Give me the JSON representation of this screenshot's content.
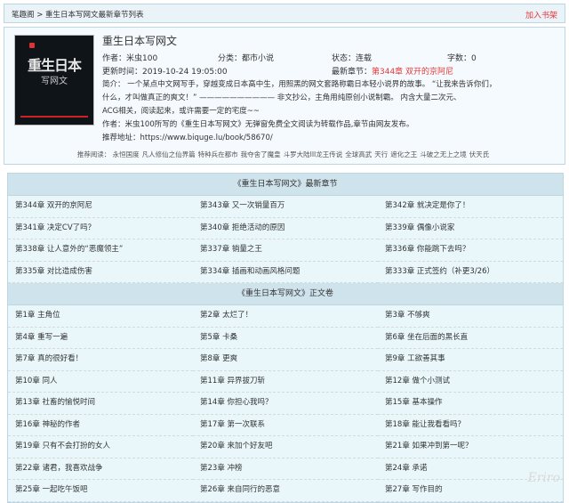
{
  "topbar": {
    "breadcrumb": "笔趣阁 > 重生日本写网文最新章节列表",
    "add_shelf": "加入书架"
  },
  "book": {
    "title": "重生日本写网文",
    "cover_title": "重生日本",
    "cover_subtitle": "写网文",
    "author": "作者：米虫100",
    "category": "分类：都市小说",
    "status": "状态：连载",
    "words": "字数：0",
    "updated": "更新时间：2019-10-24 19:05:00",
    "latest_label": "最新章节：",
    "latest_chapter": "第344章 双开的京阿尼",
    "intro_line1": "简介：           一个某点中文网写手，穿越变成日本高中生，用照黑的网文套路称霸日本轻小说界的故事。        “让我来告诉你们，",
    "intro_line2": "什么，才叫做真正的爽文！”          ——————————           非文抄公，主角用纯原创小说制霸。        内含大量二次元、",
    "intro_line3": "ACG相关，阅读起来，或许需要一定的宅度~~",
    "statement": "作者：米虫100所写的《重生日本写网文》无弹窗免费全文阅读为转载作品,章节由网友发布。",
    "address": "推荐地址：https://www.biquge.lu/book/58670/"
  },
  "recommend": {
    "label": "推荐阅读：",
    "items": [
      "永恒国度",
      "凡人修仙之仙界篇",
      "特种兵在都市",
      "我夺舍了魔皇",
      "斗罗大陆III龙王传说",
      "全球高武",
      "天行",
      "遮化之王",
      "斗破之无上之境",
      "伏天氏"
    ]
  },
  "latest_section": {
    "header": "《重生日本写网文》最新章节",
    "chapters": [
      "第344章 双开的京阿尼",
      "第343章 又一次销量百万",
      "第342章 就决定是你了！",
      "第341章 决定CV了吗？",
      "第340章 拒绝活动的原因",
      "第339章 偶像小说家",
      "第338章 让人意外的“恶魔领主”",
      "第337章 销量之王",
      "第336章 你能跳下去吗？",
      "第335章 对比造成伤害",
      "第334章 插画和动画风格问题",
      "第333章 正式签约（补更3/26）"
    ]
  },
  "main_section": {
    "header": "《重生日本写网文》正文卷",
    "chapters": [
      "第1章 主角位",
      "第2章 太烂了！",
      "第3章 不够爽",
      "第4章 重写一遍",
      "第5章 卡桑",
      "第6章 坐在后面的黑长直",
      "第7章 真的很好看！",
      "第8章 更爽",
      "第9章 工欲善其事",
      "第10章 同人",
      "第11章 异界拔刀斩",
      "第12章 做个小测试",
      "第13章 社畜的愉悦时间",
      "第14章 你担心我吗？",
      "第15章 基本操作",
      "第16章 神秘的作者",
      "第17章 第一次联系",
      "第18章 能让我看看吗？",
      "第19章 只有不会打扮的女人",
      "第20章 来加个好友吧",
      "第21章 如果冲到第一呢？",
      "第22章 诸君，我喜欢战争",
      "第23章 冲榜",
      "第24章 承诺",
      "第25章 一起吃午饭吧",
      "第26章 来自同行的恶意",
      "第27章 写作目的"
    ]
  },
  "watermark": "Eriro"
}
